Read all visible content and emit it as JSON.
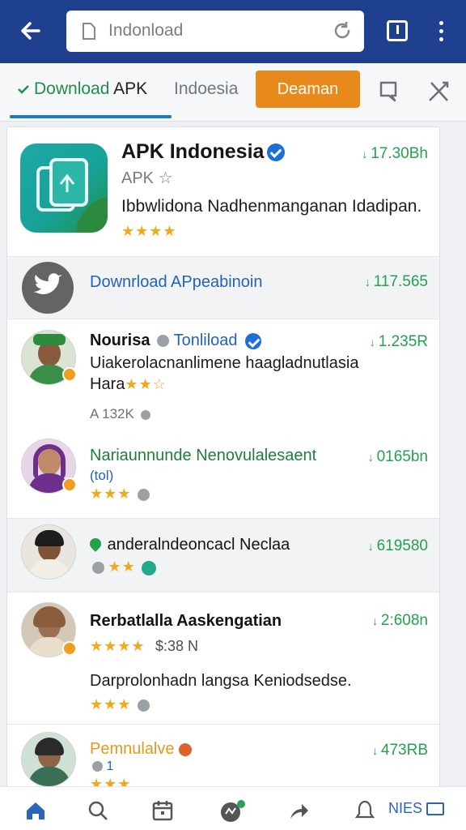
{
  "browser": {
    "url": "Indonload"
  },
  "filter_bar": {
    "tab_download_prefix": "Download",
    "tab_download_apk": "APK",
    "tab_indonesia": "Indoesia",
    "orange_button": "Deaman"
  },
  "featured": {
    "name": "APK Indonesia",
    "tag": "APK ☆",
    "description": "Ibbwlidona Nadhenmanganan Idadipan.",
    "stars": "★★★★",
    "stat": "17.30Bh"
  },
  "download_row": {
    "label": "Downrload APpeabinoin",
    "stat": "117.565"
  },
  "results": [
    {
      "name": "Nourisa",
      "name_link": "Tonliload",
      "line": "Uiakerolacnanlimene haagladnutlasia",
      "line2": "Hara",
      "stars": "★★☆",
      "meta": "A 132K",
      "stat": "1.235R"
    },
    {
      "name": "Nariaunnunde Nenovulalesaent",
      "sub": "(tol)",
      "stars": "★★★",
      "stat": "0165bn"
    },
    {
      "name": "anderalndeoncacl Neclaa",
      "stars": "★★",
      "stat": "619580"
    },
    {
      "name": "Rerbatlalla Aaskengatian",
      "stars": "★★★★",
      "price": "$:38 N",
      "line": "Darprolonhadn langsa Keniodsedse.",
      "stars2": "★★★",
      "stat": "2:608n"
    },
    {
      "name": "Pemnulalve",
      "sub": "1",
      "stars": "★★★",
      "stat": "473RB"
    }
  ],
  "bottom_nav": {
    "label": "NIES"
  },
  "colors": {
    "header": "#1f3f8f",
    "accent_orange": "#e8891c",
    "green": "#24a04f",
    "link_blue": "#2261c4"
  }
}
